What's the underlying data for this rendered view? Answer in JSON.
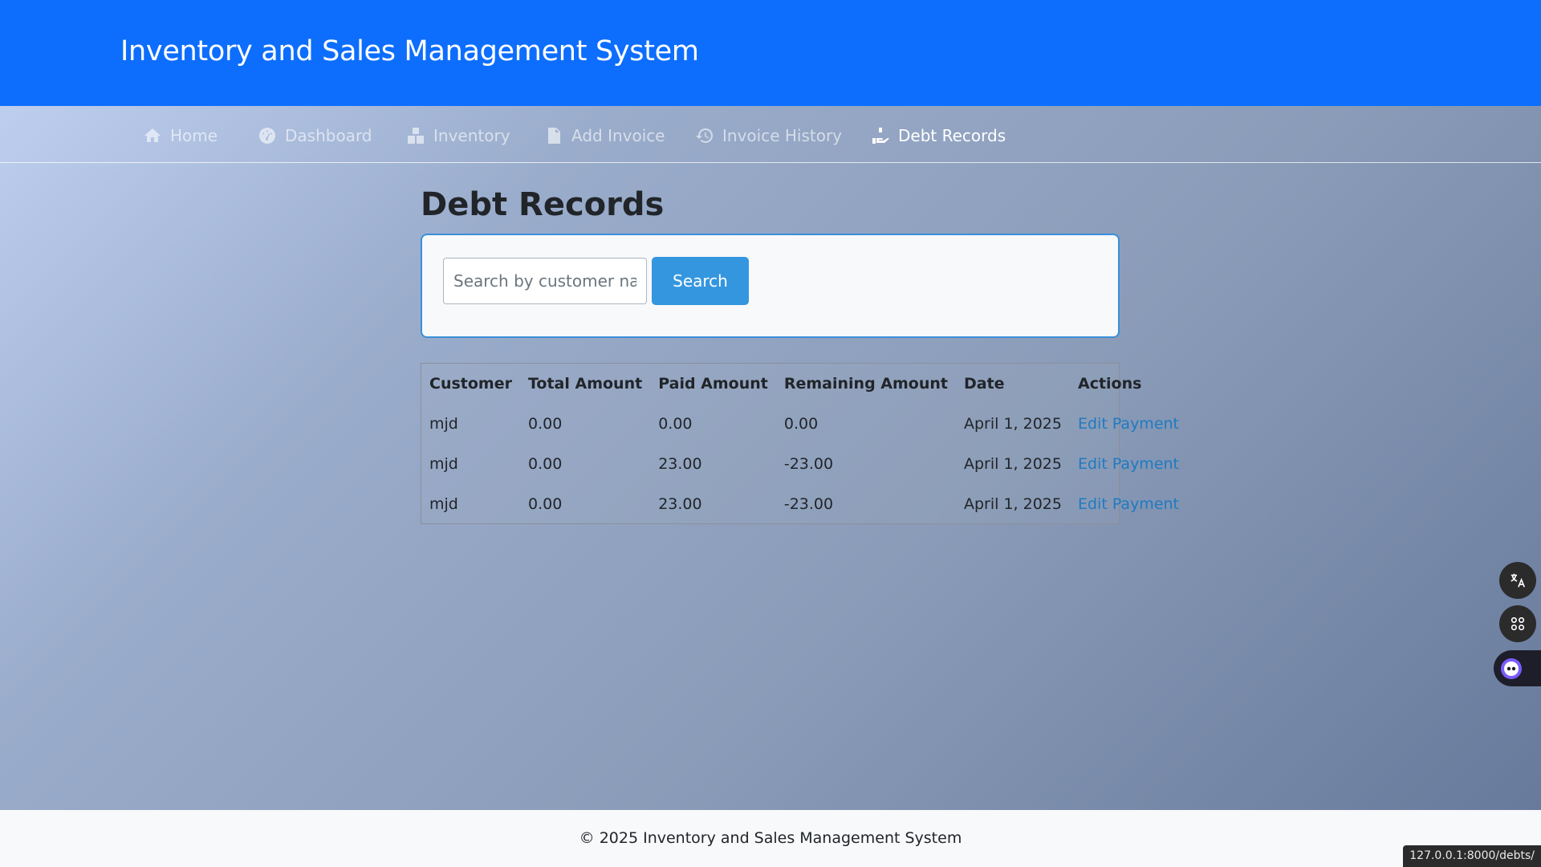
{
  "app": {
    "title": "Inventory and Sales Management System"
  },
  "nav": {
    "items": [
      {
        "label": "Home",
        "icon": "home-icon",
        "active": false
      },
      {
        "label": "Dashboard",
        "icon": "gauge-icon",
        "active": false
      },
      {
        "label": "Inventory",
        "icon": "boxes-icon",
        "active": false
      },
      {
        "label": "Add Invoice",
        "icon": "invoice-icon",
        "active": false
      },
      {
        "label": "Invoice History",
        "icon": "history-icon",
        "active": false
      },
      {
        "label": "Debt Records",
        "icon": "hand-holding-icon",
        "active": true
      }
    ]
  },
  "page": {
    "title": "Debt Records"
  },
  "search": {
    "placeholder": "Search by customer name",
    "value": "",
    "button_label": "Search"
  },
  "table": {
    "headers": [
      "Customer",
      "Total Amount",
      "Paid Amount",
      "Remaining Amount",
      "Date",
      "Actions"
    ],
    "rows": [
      {
        "customer": "mjd",
        "total": "0.00",
        "paid": "0.00",
        "remaining": "0.00",
        "date": "April 1, 2025",
        "action": "Edit Payment"
      },
      {
        "customer": "mjd",
        "total": "0.00",
        "paid": "23.00",
        "remaining": "-23.00",
        "date": "April 1, 2025",
        "action": "Edit Payment"
      },
      {
        "customer": "mjd",
        "total": "0.00",
        "paid": "23.00",
        "remaining": "-23.00",
        "date": "April 1, 2025",
        "action": "Edit Payment"
      }
    ]
  },
  "footer": {
    "text": "© 2025 Inventory and Sales Management System"
  },
  "status_bar": {
    "url": "127.0.0.1:8000/debts/"
  },
  "colors": {
    "header": "#0d6efd",
    "accent": "#3596e0",
    "link": "#1f7ac2",
    "footer": "#f8f9fb"
  },
  "side_tools": [
    "translate-icon",
    "apps-grid-icon",
    "assistant-icon"
  ]
}
